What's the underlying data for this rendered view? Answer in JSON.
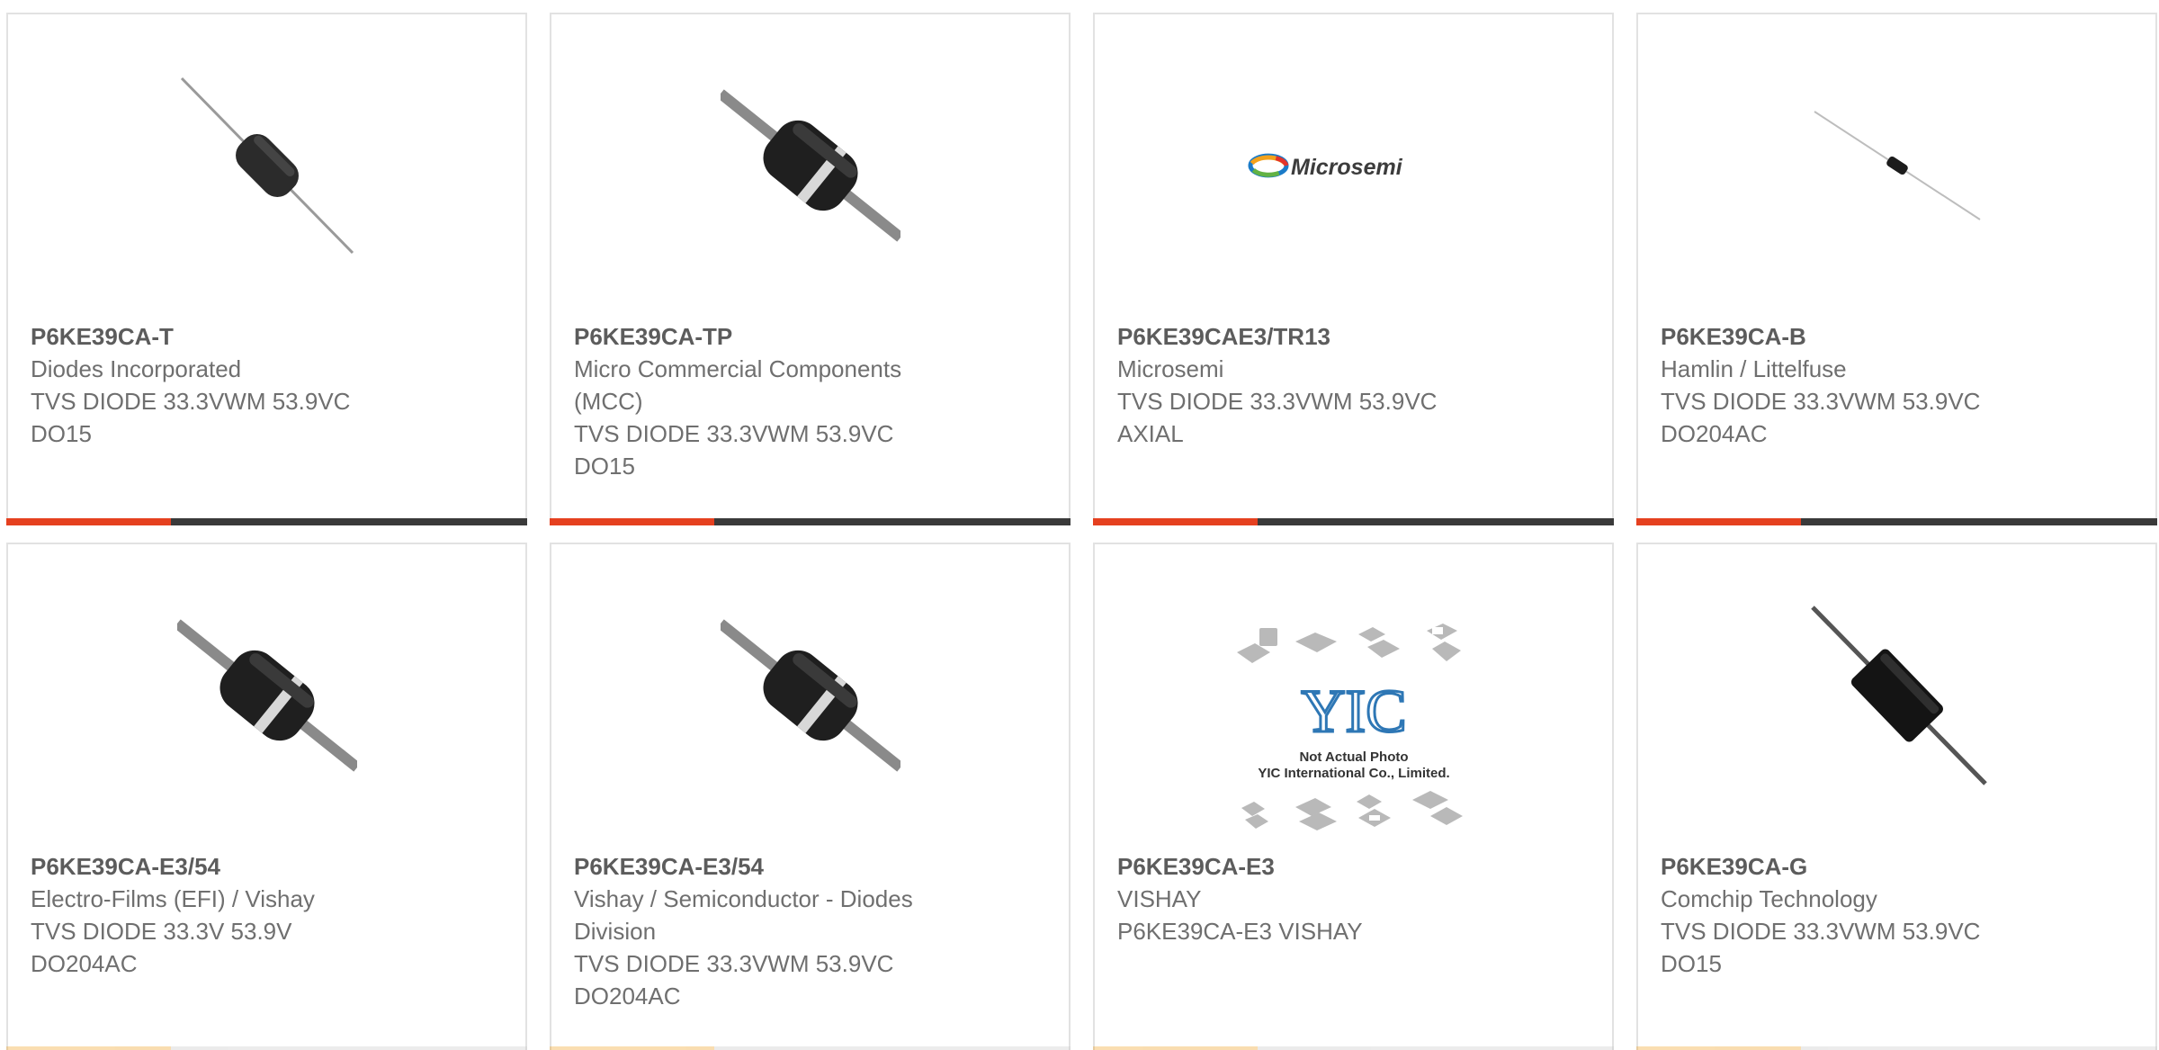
{
  "colors": {
    "accent": "#e5401f",
    "bar_dark": "#3a3a3a",
    "text": "#6f6f6f",
    "border": "#e2e2e2"
  },
  "products": [
    {
      "part_number": "P6KE39CA-T",
      "manufacturer": "Diodes Incorporated",
      "description": "TVS DIODE 33.3VWM 53.9VC",
      "package": "DO15",
      "image": "axial-diode-thin-image"
    },
    {
      "part_number": "P6KE39CA-TP",
      "manufacturer": "Micro Commercial Components (MCC)",
      "description": "TVS DIODE 33.3VWM 53.9VC",
      "package": "DO15",
      "image": "axial-diode-banded-image"
    },
    {
      "part_number": "P6KE39CAE3/TR13",
      "manufacturer": "Microsemi",
      "description": "TVS DIODE 33.3VWM 53.9VC",
      "package": "AXIAL",
      "image": "microsemi-logo-image",
      "logo_text": "Microsemi"
    },
    {
      "part_number": "P6KE39CA-B",
      "manufacturer": "Hamlin / Littelfuse",
      "description": "TVS DIODE 33.3VWM 53.9VC",
      "package": "DO204AC",
      "image": "axial-diode-small-image"
    },
    {
      "part_number": "P6KE39CA-E3/54",
      "manufacturer": "Electro-Films (EFI) / Vishay",
      "description": "TVS DIODE 33.3V 53.9V",
      "package": "DO204AC",
      "image": "axial-diode-banded-image"
    },
    {
      "part_number": "P6KE39CA-E3/54",
      "manufacturer": "Vishay / Semiconductor - Diodes Division",
      "description": "TVS DIODE 33.3VWM 53.9VC",
      "package": "DO204AC",
      "image": "axial-diode-banded-image"
    },
    {
      "part_number": "P6KE39CA-E3",
      "manufacturer": "VISHAY",
      "description": "P6KE39CA-E3 VISHAY",
      "package": "",
      "image": "placeholder-not-actual-photo-image",
      "placeholder_brand": "YIC",
      "placeholder_line1": "Not Actual Photo",
      "placeholder_line2": "YIC International Co., Limited."
    },
    {
      "part_number": "P6KE39CA-G",
      "manufacturer": "Comchip Technology",
      "description": "TVS DIODE 33.3VWM 53.9VC",
      "package": "DO15",
      "image": "axial-diode-large-image"
    }
  ]
}
